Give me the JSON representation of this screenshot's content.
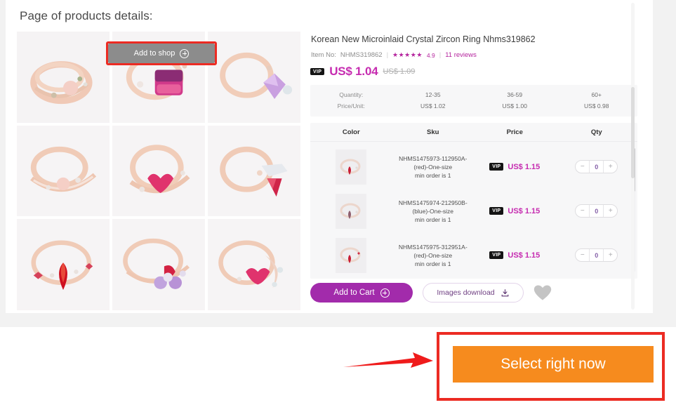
{
  "page": {
    "title": "Page of products details:"
  },
  "gallery": {
    "overlay_button": {
      "label": "Add to shop",
      "icon": "plus-circle-icon",
      "highlight_color": "#ec2b23",
      "background": "#8c8c8c"
    },
    "cells": [
      {
        "alt": "rose-gold-double-band-ring-with-pink-heart-stone"
      },
      {
        "alt": "rose-gold-ring-with-large-pink-purple-square-gem"
      },
      {
        "alt": "rose-gold-ring-with-lavender-heart-gem"
      },
      {
        "alt": "rose-gold-crown-ring-with-pink-opal-heart"
      },
      {
        "alt": "rose-gold-open-ring-with-red-heart-gem"
      },
      {
        "alt": "rose-gold-ring-with-red-pear-gem-and-leaves"
      },
      {
        "alt": "rose-gold-ring-with-red-marquise-gem-and-stars"
      },
      {
        "alt": "rose-gold-ring-with-red-and-purple-cluster-gems"
      },
      {
        "alt": "rose-gold-crescent-ring-with-pink-gem-cluster"
      }
    ]
  },
  "product": {
    "title": "Korean New Microinlaid Crystal Zircon Ring Nhms319862",
    "item_no_label": "Item No:",
    "item_no": "NHMS319862",
    "stars": "★★★★★",
    "rating": "4.9",
    "reviews": "11 reviews",
    "vip_badge": "VIP",
    "price": "US$ 1.04",
    "price_original": "US$ 1.09",
    "accent_color": "#c62bb0"
  },
  "tier_pricing": {
    "quantity_label": "Quantity:",
    "price_label": "Price/Unit:",
    "tiers": [
      {
        "range": "12-35",
        "price": "US$ 1.02"
      },
      {
        "range": "36-59",
        "price": "US$ 1.00"
      },
      {
        "range": "60+",
        "price": "US$ 0.98"
      }
    ]
  },
  "sku_table": {
    "columns": [
      "Color",
      "Sku",
      "Price",
      "Qty"
    ],
    "rows": [
      {
        "thumb_alt": "red-zircon-ring-thumbnail",
        "sku": "NHMS1475973-112950A-",
        "variant": "(red)-One-size",
        "min_order": "min order is 1",
        "vip_badge": "VIP",
        "price": "US$ 1.15",
        "qty": "0",
        "minus": "−",
        "plus": "+"
      },
      {
        "thumb_alt": "blue-zircon-ring-thumbnail",
        "sku": "NHMS1475974-212950B-",
        "variant": "(blue)-One-size",
        "min_order": "min order is 1",
        "vip_badge": "VIP",
        "price": "US$ 1.15",
        "qty": "0",
        "minus": "−",
        "plus": "+"
      },
      {
        "thumb_alt": "red-zircon-star-ring-thumbnail",
        "sku": "NHMS1475975-312951A-",
        "variant": "(red)-One-size",
        "min_order": "min order is 1",
        "vip_badge": "VIP",
        "price": "US$ 1.15",
        "qty": "0",
        "minus": "−",
        "plus": "+"
      }
    ]
  },
  "actions": {
    "add_to_cart": "Add to Cart",
    "add_to_cart_icon": "plus-circle-icon",
    "images_download": "Images download",
    "images_download_icon": "download-icon",
    "favorite_icon": "heart-icon"
  },
  "callout": {
    "cta_label": "Select right now",
    "cta_background": "#f68b1e",
    "highlight_color": "#ec2b23",
    "arrow_icon": "red-right-arrow-icon"
  }
}
